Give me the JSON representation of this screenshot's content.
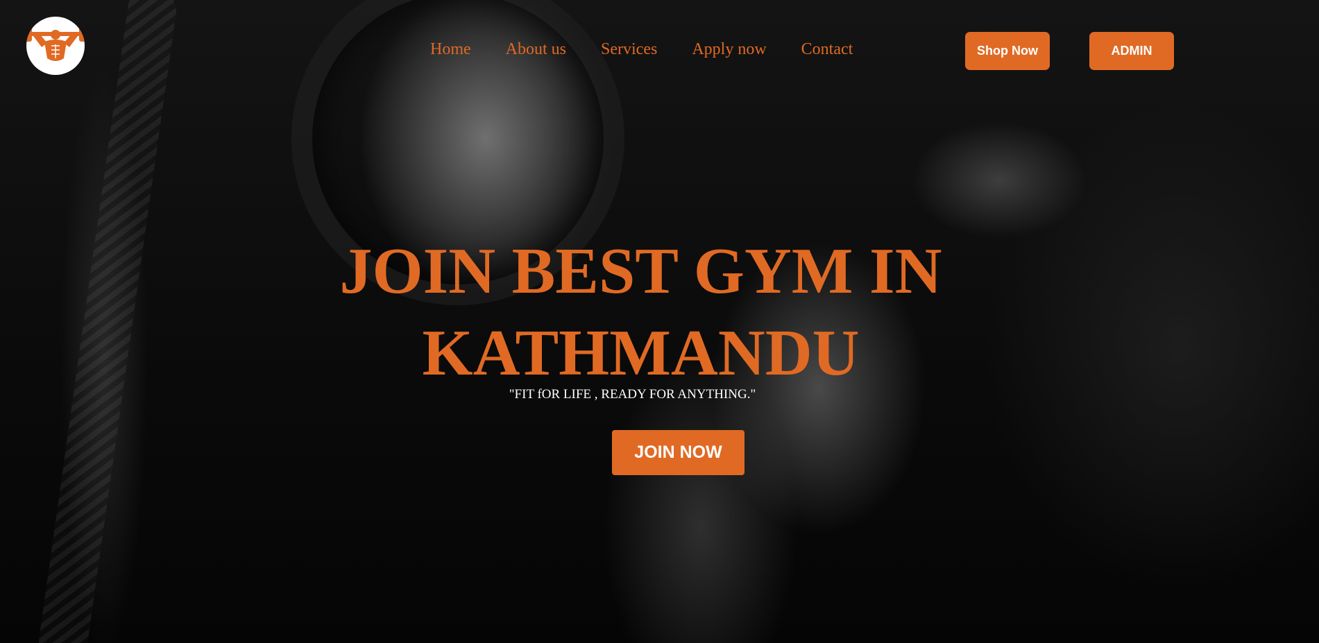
{
  "brand": {
    "logo_icon": "bodybuilder-dumbbell-icon",
    "accent_color": "#e06a24"
  },
  "nav": {
    "items": [
      {
        "label": "Home"
      },
      {
        "label": "About us"
      },
      {
        "label": "Services"
      },
      {
        "label": "Apply now"
      },
      {
        "label": "Contact"
      }
    ]
  },
  "header_buttons": {
    "shop_label": "Shop Now",
    "admin_label": "ADMIN"
  },
  "hero": {
    "title_line1": "JOIN BEST GYM IN",
    "title_line2": "KATHMANDU",
    "tagline": "\"FIT fOR LIFE , READY FOR ANYTHING.\"",
    "cta_label": "JOIN NOW"
  }
}
